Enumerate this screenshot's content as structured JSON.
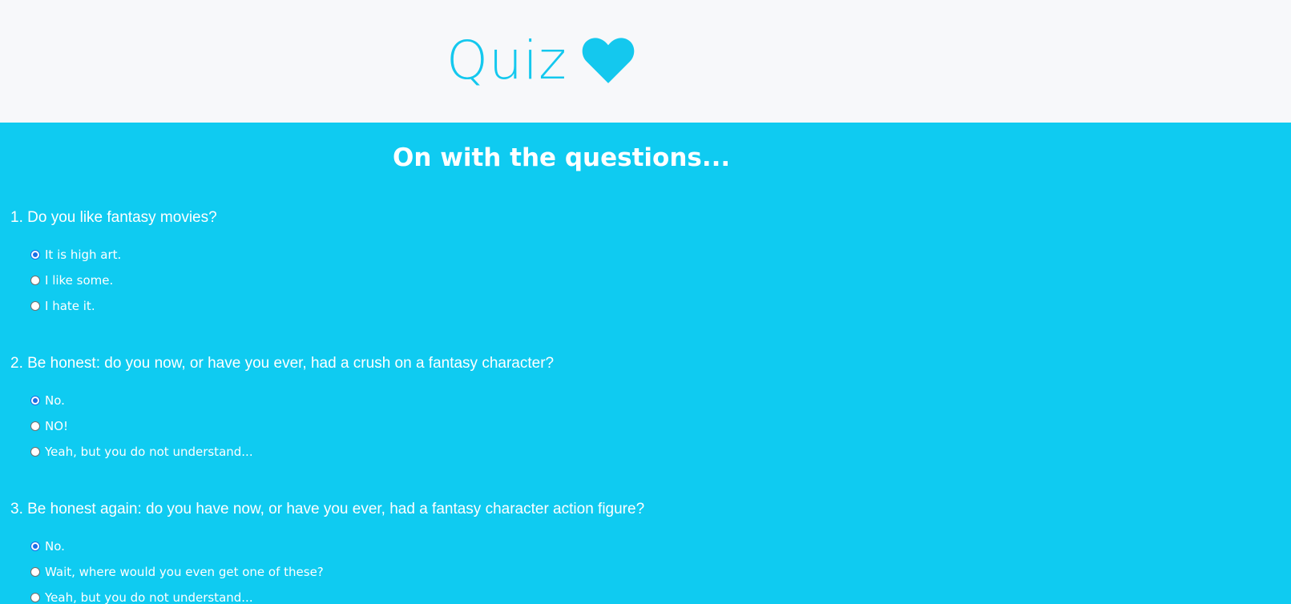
{
  "header": {
    "title": "Quiz",
    "icon": "heart-icon",
    "accent_color": "#14C8EE"
  },
  "main": {
    "background_color": "#0FCBF1",
    "section_title": "On with the questions...",
    "questions": [
      {
        "text": "1. Do you like fantasy movies?",
        "options": [
          "It is high art.",
          "I like some.",
          "I hate it."
        ],
        "selected_index": 0
      },
      {
        "text": "2. Be honest: do you now, or have you ever, had a crush on a fantasy character?",
        "options": [
          "No.",
          "NO!",
          "Yeah, but you do not understand..."
        ],
        "selected_index": 0
      },
      {
        "text": "3. Be honest again: do you have now, or have you ever, had a fantasy character action figure?",
        "options": [
          "No.",
          "Wait, where would you even get one of these?",
          "Yeah, but you do not understand..."
        ],
        "selected_index": 0
      }
    ]
  }
}
